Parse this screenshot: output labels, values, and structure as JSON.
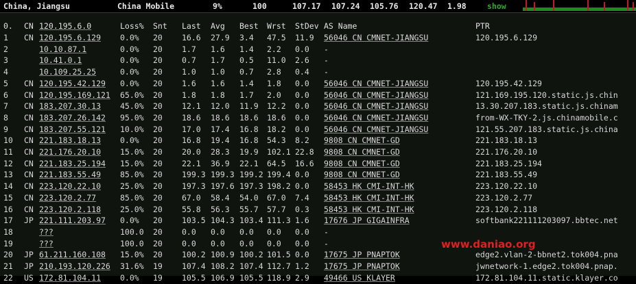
{
  "topbar": {
    "location": "China, Jiangsu",
    "isp": "China Mobile",
    "loss": "9%",
    "count": "100",
    "last": "107.17",
    "avg": "107.24",
    "best": "105.76",
    "worst": "120.47",
    "stdev": "1.98",
    "show_label": "show"
  },
  "headers": [
    "0.",
    "CN",
    "120.195.6.0",
    "Loss%",
    "Snt",
    "Last",
    "Avg",
    "Best",
    "Wrst",
    "StDev",
    "AS Name",
    "PTR"
  ],
  "rows": [
    [
      "1",
      "CN",
      "120.195.6.129",
      "0.0%",
      "20",
      "16.6",
      "27.9",
      "3.4",
      "47.5",
      "11.9",
      "56046 CN CMNET-JIANGSU",
      "120.195.6.129"
    ],
    [
      "2",
      "",
      "10.10.87.1",
      "0.0%",
      "20",
      "1.7",
      "1.6",
      "1.4",
      "2.2",
      "0.0",
      "-",
      ""
    ],
    [
      "3",
      "",
      "10.41.0.1",
      "0.0%",
      "20",
      "0.7",
      "1.7",
      "0.5",
      "11.0",
      "2.6",
      "-",
      ""
    ],
    [
      "4",
      "",
      "10.109.25.25",
      "0.0%",
      "20",
      "1.0",
      "1.0",
      "0.7",
      "2.8",
      "0.4",
      "-",
      ""
    ],
    [
      "5",
      "CN",
      "120.195.42.129",
      "0.0%",
      "20",
      "1.6",
      "1.6",
      "1.4",
      "1.8",
      "0.0",
      "56046 CN CMNET-JIANGSU",
      "120.195.42.129"
    ],
    [
      "6",
      "CN",
      "120.195.169.121",
      "65.0%",
      "20",
      "1.8",
      "1.8",
      "1.7",
      "2.0",
      "0.0",
      "56046 CN CMNET-JIANGSU",
      "121.169.195.120.static.js.chin"
    ],
    [
      "7",
      "CN",
      "183.207.30.13",
      "45.0%",
      "20",
      "12.1",
      "12.0",
      "11.9",
      "12.2",
      "0.0",
      "56046 CN CMNET-JIANGSU",
      "13.30.207.183.static.js.chinam"
    ],
    [
      "8",
      "CN",
      "183.207.26.142",
      "95.0%",
      "20",
      "18.6",
      "18.6",
      "18.6",
      "18.6",
      "0.0",
      "56046 CN CMNET-JIANGSU",
      "from-WX-TKY-2.js.chinamobile.c"
    ],
    [
      "9",
      "CN",
      "183.207.55.121",
      "10.0%",
      "20",
      "17.0",
      "17.4",
      "16.8",
      "18.2",
      "0.0",
      "56046 CN CMNET-JIANGSU",
      "121.55.207.183.static.js.china"
    ],
    [
      "10",
      "CN",
      "221.183.18.13",
      "0.0%",
      "20",
      "16.8",
      "19.4",
      "16.8",
      "54.3",
      "8.2",
      "9808  CN CMNET-GD",
      "221.183.18.13"
    ],
    [
      "11",
      "CN",
      "221.176.20.10",
      "15.0%",
      "20",
      "20.0",
      "28.3",
      "19.9",
      "102.1",
      "22.8",
      "9808  CN CMNET-GD",
      "221.176.20.10"
    ],
    [
      "12",
      "CN",
      "221.183.25.194",
      "15.0%",
      "20",
      "22.1",
      "36.9",
      "22.1",
      "64.5",
      "16.6",
      "9808  CN CMNET-GD",
      "221.183.25.194"
    ],
    [
      "13",
      "CN",
      "221.183.55.49",
      "85.0%",
      "20",
      "199.3",
      "199.3",
      "199.2",
      "199.4",
      "0.0",
      "9808  CN CMNET-GD",
      "221.183.55.49"
    ],
    [
      "14",
      "CN",
      "223.120.22.10",
      "25.0%",
      "20",
      "197.3",
      "197.6",
      "197.3",
      "198.2",
      "0.0",
      "58453 HK CMI-INT-HK",
      "223.120.22.10"
    ],
    [
      "15",
      "CN",
      "223.120.2.77",
      "85.0%",
      "20",
      "67.0",
      "58.4",
      "54.0",
      "67.0",
      "7.4",
      "58453 HK CMI-INT-HK",
      "223.120.2.77"
    ],
    [
      "16",
      "CN",
      "223.120.2.118",
      "25.0%",
      "20",
      "55.8",
      "56.3",
      "55.7",
      "57.7",
      "0.3",
      "58453 HK CMI-INT-HK",
      "223.120.2.118"
    ],
    [
      "17",
      "JP",
      "221.111.203.97",
      "0.0%",
      "20",
      "103.5",
      "104.3",
      "103.4",
      "111.3",
      "1.6",
      "17676 JP GIGAINFRA",
      "softbank221111203097.bbtec.net"
    ],
    [
      "18",
      "",
      "???",
      "100.0",
      "20",
      "0.0",
      "0.0",
      "0.0",
      "0.0",
      "0.0",
      "-",
      ""
    ],
    [
      "19",
      "",
      "???",
      "100.0",
      "20",
      "0.0",
      "0.0",
      "0.0",
      "0.0",
      "0.0",
      "-",
      ""
    ],
    [
      "20",
      "JP",
      "61.211.160.108",
      "15.0%",
      "20",
      "100.2",
      "100.9",
      "100.2",
      "101.5",
      "0.0",
      "17675 JP PNAPTOK",
      "edge2.vlan-2-bbnet2.tok004.pna"
    ],
    [
      "21",
      "JP",
      "210.193.120.226",
      "31.6%",
      "19",
      "107.4",
      "108.2",
      "107.4",
      "112.7",
      "1.2",
      "17675 JP PNAPTOK",
      "jwnetwork-1.edge2.tok004.pnap."
    ],
    [
      "22",
      "US",
      "172.81.104.11",
      "0.0%",
      "19",
      "105.5",
      "106.9",
      "105.5",
      "118.9",
      "2.9",
      "49466 US KLAYER",
      "172.81.104.11.static.klayer.co"
    ]
  ],
  "watermark": "www.daniao.org",
  "colors": {
    "background": "#0f140f",
    "text": "#d8d8d8",
    "green": "#2fa82f",
    "red": "#c21d1d"
  }
}
